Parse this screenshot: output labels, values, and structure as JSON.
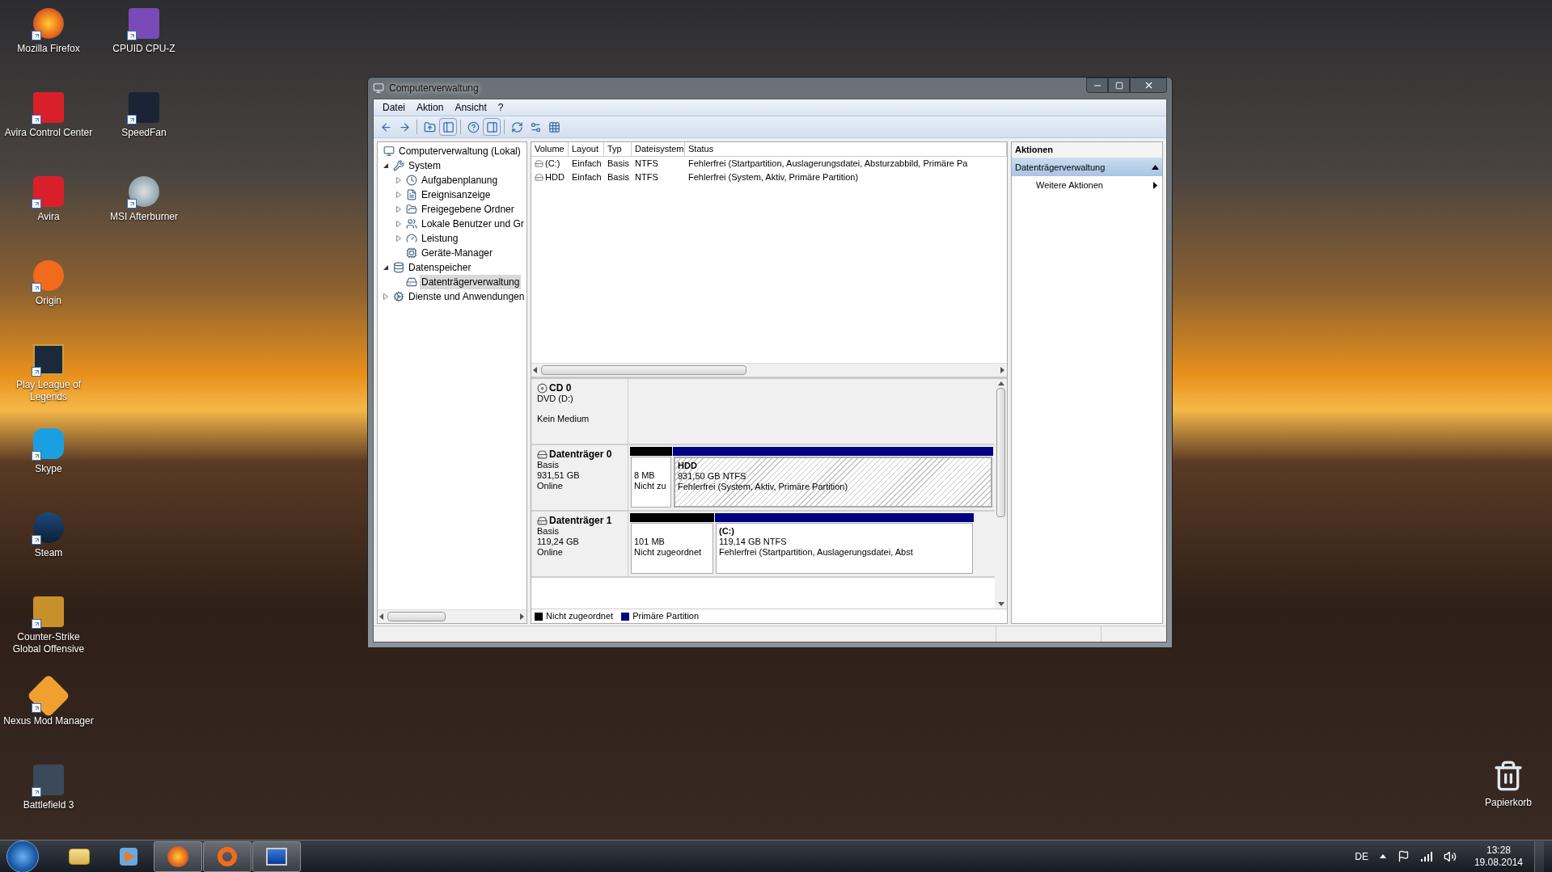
{
  "desktop_icons": [
    {
      "label": "Mozilla Firefox"
    },
    {
      "label": "Avira Control Center"
    },
    {
      "label": "Avira"
    },
    {
      "label": "Origin"
    },
    {
      "label": "Play League of Legends"
    },
    {
      "label": "Skype"
    },
    {
      "label": "Steam"
    },
    {
      "label": "Counter-Strike Global Offensive"
    },
    {
      "label": "Nexus Mod Manager"
    },
    {
      "label": "Battlefield 3"
    },
    {
      "label": "CPUID CPU-Z"
    },
    {
      "label": "SpeedFan"
    },
    {
      "label": "MSI Afterburner"
    }
  ],
  "recycle_bin": {
    "label": "Papierkorb"
  },
  "window": {
    "title": "Computerverwaltung",
    "menu": [
      "Datei",
      "Aktion",
      "Ansicht",
      "?"
    ],
    "tree": [
      {
        "label": "Computerverwaltung (Lokal)",
        "selected": false,
        "children": [
          {
            "label": "System",
            "expanded": true,
            "selected": false,
            "children": [
              {
                "label": "Aufgabenplanung",
                "expanded": false,
                "selected": false
              },
              {
                "label": "Ereignisanzeige",
                "expanded": false,
                "selected": false
              },
              {
                "label": "Freigegebene Ordner",
                "expanded": false,
                "selected": false
              },
              {
                "label": "Lokale Benutzer und Gr",
                "expanded": false,
                "selected": false
              },
              {
                "label": "Leistung",
                "expanded": false,
                "selected": false
              },
              {
                "label": "Geräte-Manager",
                "selected": false
              }
            ]
          },
          {
            "label": "Datenspeicher",
            "expanded": true,
            "selected": false,
            "children": [
              {
                "label": "Datenträgerverwaltung",
                "selected": true
              }
            ]
          },
          {
            "label": "Dienste und Anwendungen",
            "expanded": false,
            "selected": false
          }
        ]
      }
    ],
    "volume_table": {
      "columns": [
        "Volume",
        "Layout",
        "Typ",
        "Dateisystem",
        "Status"
      ],
      "rows": [
        [
          "(C:)",
          "Einfach",
          "Basis",
          "NTFS",
          "Fehlerfrei (Startpartition, Auslagerungsdatei, Absturzabbild, Primäre Pa"
        ],
        [
          "HDD",
          "Einfach",
          "Basis",
          "NTFS",
          "Fehlerfrei (System, Aktiv, Primäre Partition)"
        ]
      ]
    },
    "disks": [
      {
        "kind": "cd",
        "name": "CD 0",
        "drive": "DVD (D:)",
        "medium": "Kein Medium"
      },
      {
        "kind": "disk",
        "name": "Datenträger 0",
        "type": "Basis",
        "size": "931,51 GB",
        "state": "Online",
        "partitions": [
          {
            "kind": "unallocated",
            "selected": false,
            "size": "8 MB",
            "status": "Nicht zu"
          },
          {
            "kind": "primary",
            "selected": true,
            "name": "HDD",
            "size": "931,50 GB NTFS",
            "status": "Fehlerfrei (System, Aktiv, Primäre Partition)"
          }
        ]
      },
      {
        "kind": "disk",
        "name": "Datenträger 1",
        "type": "Basis",
        "size": "119,24 GB",
        "state": "Online",
        "partitions": [
          {
            "kind": "unallocated",
            "selected": false,
            "size": "101 MB",
            "status": "Nicht zugeordnet"
          },
          {
            "kind": "primary",
            "selected": false,
            "name": "(C:)",
            "size": "119,14 GB NTFS",
            "status": "Fehlerfrei (Startpartition, Auslagerungsdatei, Abst"
          }
        ]
      }
    ],
    "legend": [
      {
        "label": "Nicht zugeordnet",
        "color": "#000000"
      },
      {
        "label": "Primäre Partition",
        "color": "#000080"
      }
    ],
    "actions": {
      "header": "Aktionen",
      "section": "Datenträgerverwaltung",
      "expanded": true,
      "items": [
        "Weitere Aktionen"
      ]
    }
  },
  "taskbar": {
    "apps": [
      {
        "open": false
      },
      {
        "open": false
      },
      {
        "open": true
      },
      {
        "open": true
      },
      {
        "open": true
      }
    ],
    "language": "DE",
    "time": "13:28",
    "date": "19.08.2014"
  }
}
